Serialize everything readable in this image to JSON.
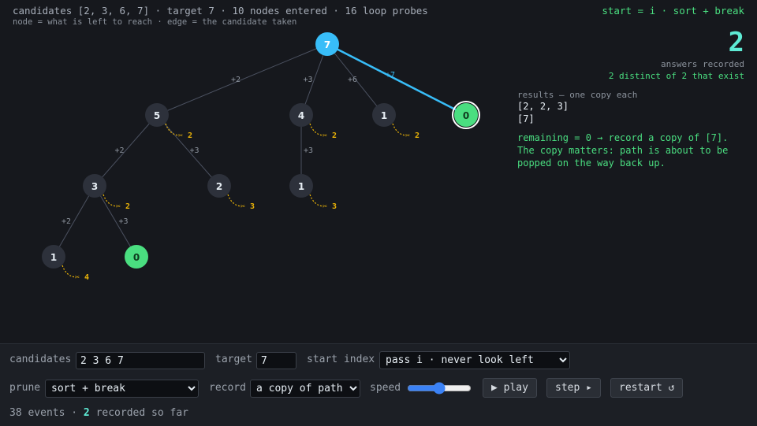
{
  "header": {
    "stats": "candidates [2, 3, 6, 7] · target 7 · 10 nodes entered · 16 loop probes",
    "legend": "node = what is left to reach · edge = the candidate taken",
    "mode": "start = i · sort + break"
  },
  "summary": {
    "count": "2",
    "count_label": "answers recorded",
    "distinct": "2 distinct of 2 that exist"
  },
  "results": {
    "title": "results — one copy each",
    "items": [
      "[2, 2, 3]",
      "[7]"
    ]
  },
  "note": "remaining = 0 → record a copy of [7]. The copy matters: path is about to be popped on the way back up.",
  "tree": {
    "nodes": [
      {
        "id": "n7",
        "label": "7",
        "state": "root"
      },
      {
        "id": "n5",
        "label": "5",
        "state": "normal"
      },
      {
        "id": "n4",
        "label": "4",
        "state": "normal"
      },
      {
        "id": "n1a",
        "label": "1",
        "state": "normal"
      },
      {
        "id": "n0a",
        "label": "0",
        "state": "hit-current"
      },
      {
        "id": "n3",
        "label": "3",
        "state": "normal"
      },
      {
        "id": "n2",
        "label": "2",
        "state": "normal"
      },
      {
        "id": "n1b",
        "label": "1",
        "state": "normal"
      },
      {
        "id": "n1c",
        "label": "1",
        "state": "normal"
      },
      {
        "id": "n0b",
        "label": "0",
        "state": "hit"
      }
    ],
    "edges": [
      {
        "from": "n7",
        "to": "n5",
        "label": "+2",
        "active": false
      },
      {
        "from": "n7",
        "to": "n4",
        "label": "+3",
        "active": false
      },
      {
        "from": "n7",
        "to": "n1a",
        "label": "+6",
        "active": false
      },
      {
        "from": "n7",
        "to": "n0a",
        "label": "+7",
        "active": true
      },
      {
        "from": "n5",
        "to": "n3",
        "label": "+2",
        "active": false
      },
      {
        "from": "n5",
        "to": "n2",
        "label": "+3",
        "active": false
      },
      {
        "from": "n4",
        "to": "n1b",
        "label": "+3",
        "active": false
      },
      {
        "from": "n3",
        "to": "n1c",
        "label": "+2",
        "active": false
      },
      {
        "from": "n3",
        "to": "n0b",
        "label": "+3",
        "active": false
      }
    ],
    "prunes": [
      {
        "node": "n5",
        "label": "✂ 2"
      },
      {
        "node": "n4",
        "label": "✂ 2"
      },
      {
        "node": "n1a",
        "label": "✂ 2"
      },
      {
        "node": "n3",
        "label": "✂ 2"
      },
      {
        "node": "n2",
        "label": "✂ 3"
      },
      {
        "node": "n1b",
        "label": "✂ 3"
      },
      {
        "node": "n1c",
        "label": "✂ 4"
      }
    ]
  },
  "controls": {
    "candidates_label": "candidates",
    "candidates_value": "2 3 6 7",
    "target_label": "target",
    "target_value": "7",
    "start_label": "start index",
    "start_value": "pass i · never look left",
    "prune_label": "prune",
    "prune_value": "sort + break",
    "record_label": "record",
    "record_value": "a copy of path",
    "speed_label": "speed",
    "play_label": "▶ play",
    "step_label": "step ▸",
    "restart_label": "restart ↺"
  },
  "footer": {
    "events": "38 events · ",
    "recorded_count": "2",
    "recorded_suffix": " recorded so far"
  },
  "colors": {
    "root": "#38bdf8",
    "hit": "#4ade80",
    "prune": "#eab308",
    "accent": "#5eead4"
  }
}
